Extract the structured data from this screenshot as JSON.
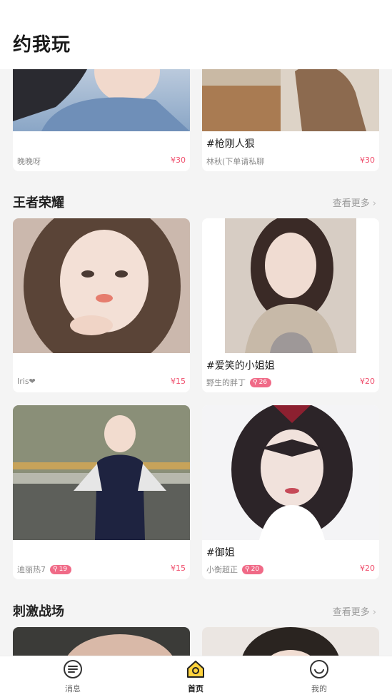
{
  "header": {
    "title": "约我玩"
  },
  "cards_top": [
    {
      "caption": "",
      "owner": "晚晚呀",
      "price": "¥30",
      "badge": ""
    },
    {
      "caption": "#枪刚人狠",
      "owner": "林秋(下单请私聊",
      "price": "¥30",
      "badge": ""
    }
  ],
  "section_wzry": {
    "title": "王者荣耀",
    "more": "查看更多",
    "cards": [
      {
        "caption": "",
        "owner": "Iris❤",
        "price": "¥15",
        "badge": ""
      },
      {
        "caption": "#爱笑的小姐姐",
        "owner": "野生的胖丁",
        "price": "¥20",
        "badge": "26"
      },
      {
        "caption": "",
        "owner": "迪丽热7",
        "price": "¥15",
        "badge": "19"
      },
      {
        "caption": "#御姐",
        "owner": "小衡超正",
        "price": "¥20",
        "badge": "20"
      }
    ]
  },
  "section_cjzc": {
    "title": "刺激战场",
    "more": "查看更多"
  },
  "tabs": [
    {
      "label": "消息",
      "icon": "message-icon"
    },
    {
      "label": "首页",
      "icon": "home-icon",
      "active": true
    },
    {
      "label": "我的",
      "icon": "smile-profile-icon"
    }
  ],
  "colors": {
    "accent": "#f0506e",
    "badge": "#f06a87",
    "home_yellow": "#ffd33d"
  }
}
